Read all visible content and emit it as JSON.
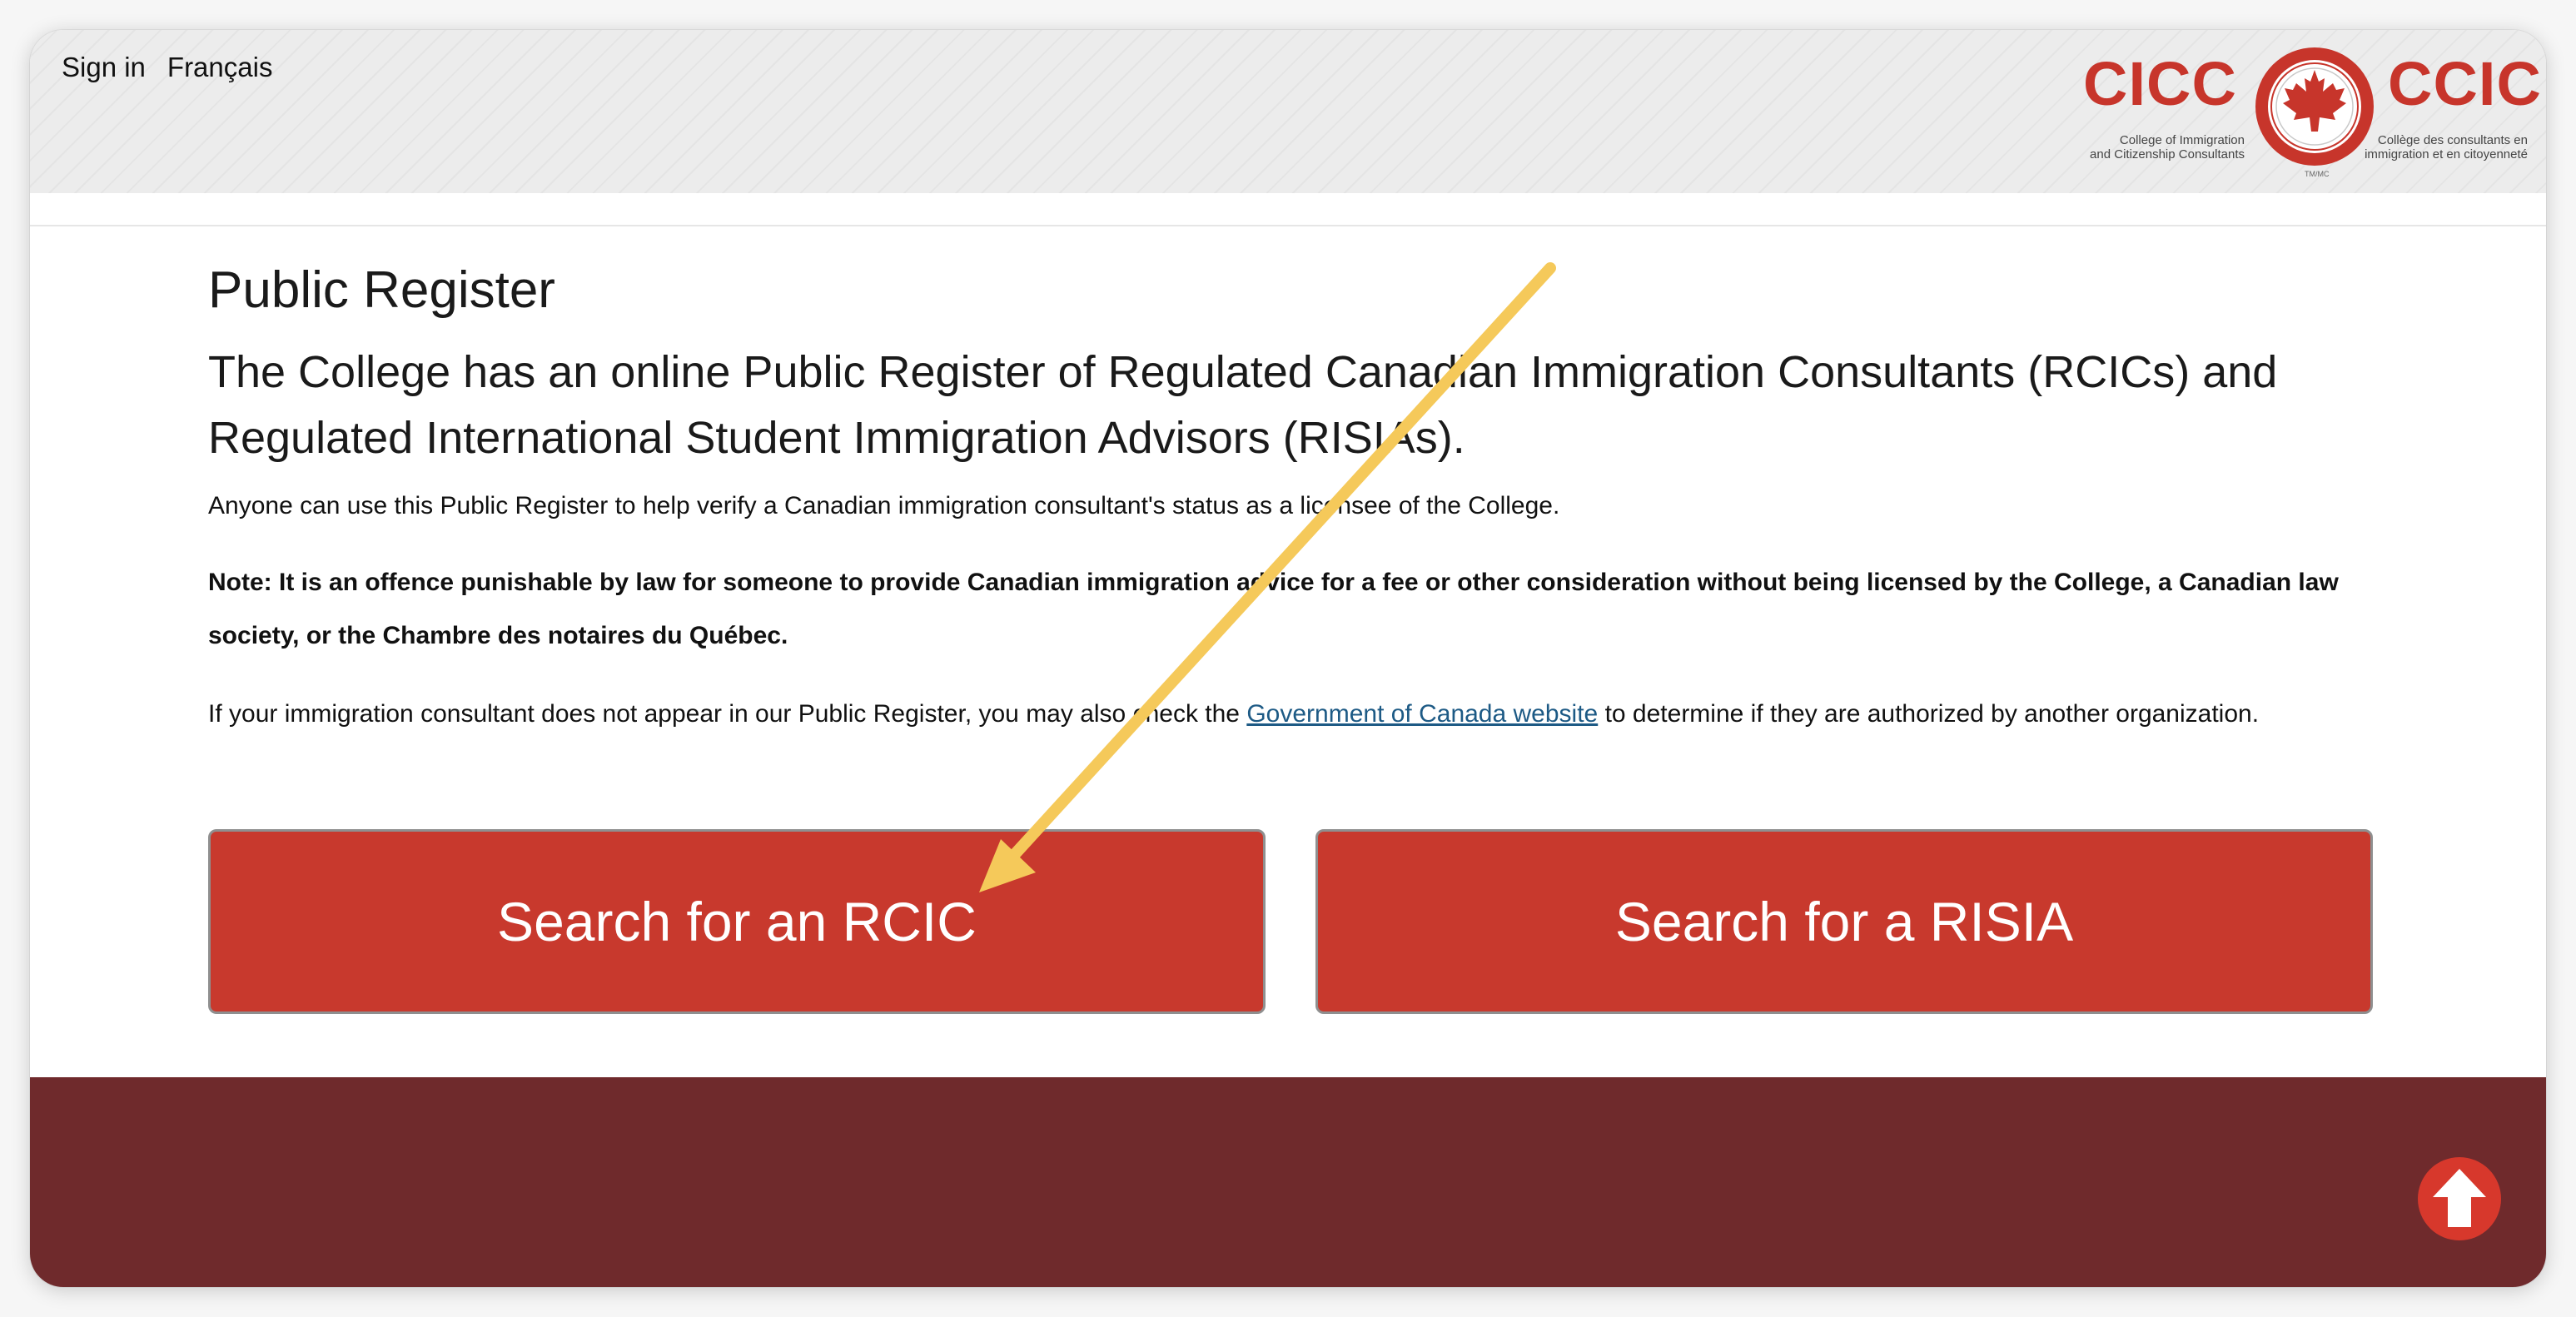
{
  "header": {
    "sign_in": "Sign in",
    "language": "Français",
    "logo": {
      "left_word": "CICC",
      "right_word": "CCIC",
      "left_sub_1": "College of Immigration",
      "left_sub_2": "and Citizenship Consultants",
      "right_sub_1": "Collège des consultants en",
      "right_sub_2": "immigration et en citoyenneté",
      "seal_mark": "TM/MC",
      "icon": "maple-leaf-seal-icon"
    }
  },
  "main": {
    "title": "Public Register",
    "lead": "The College has an online Public Register of Regulated Canadian Immigration Consultants (RCICs) and Regulated International Student Immigration Advisors (RISIAs).",
    "intro": "Anyone can use this Public Register to help verify a Canadian immigration consultant's status as a licensee of the College.",
    "note": "Note: It is an offence punishable by law for someone to provide Canadian immigration advice for a fee or other consideration without being licensed by the College, a Canadian law society, or the Chambre des notaires du Québec.",
    "gov_before": "If your immigration consultant does not appear in our Public Register, you may also check the ",
    "gov_link": "Government of Canada website",
    "gov_after": " to determine if they are authorized by another organization."
  },
  "buttons": {
    "rcic": "Search for an RCIC",
    "risia": "Search for a RISIA"
  },
  "footer": {
    "back_to_top_icon": "arrow-up-icon"
  },
  "colors": {
    "brand_red": "#c8392d",
    "footer_maroon": "#6f2a2c",
    "link_blue": "#1d5a85",
    "annotation_arrow": "#f5c95a"
  }
}
